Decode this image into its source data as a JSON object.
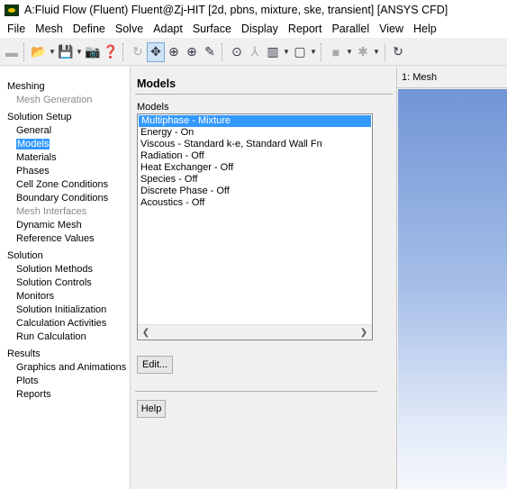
{
  "window": {
    "title": "A:Fluid Flow (Fluent) Fluent@Zj-HIT  [2d, pbns, mixture, ske, transient] [ANSYS CFD]"
  },
  "menubar": {
    "items": [
      "File",
      "Mesh",
      "Define",
      "Solve",
      "Adapt",
      "Surface",
      "Display",
      "Report",
      "Parallel",
      "View",
      "Help"
    ]
  },
  "navigation": {
    "meshing_header": "Meshing",
    "mesh_generation": "Mesh Generation",
    "solution_setup_header": "Solution Setup",
    "setup_items": [
      "General",
      "Models",
      "Materials",
      "Phases",
      "Cell Zone Conditions",
      "Boundary Conditions",
      "Mesh Interfaces",
      "Dynamic Mesh",
      "Reference Values"
    ],
    "solution_header": "Solution",
    "solution_items": [
      "Solution Methods",
      "Solution Controls",
      "Monitors",
      "Solution Initialization",
      "Calculation Activities",
      "Run Calculation"
    ],
    "results_header": "Results",
    "results_items": [
      "Graphics and Animations",
      "Plots",
      "Reports"
    ],
    "selected": "Models"
  },
  "task_page": {
    "title": "Models",
    "list_label": "Models",
    "models": [
      "Multiphase - Mixture",
      "Energy - On",
      "Viscous - Standard k-e, Standard Wall Fn",
      "Radiation - Off",
      "Heat Exchanger - Off",
      "Species - Off",
      "Discrete Phase - Off",
      "Acoustics - Off"
    ],
    "selected_model": "Multiphase - Mixture",
    "edit_button": "Edit...",
    "help_button": "Help"
  },
  "graphics": {
    "tab_label": "1: Mesh"
  },
  "colors": {
    "selection": "#3399ff",
    "viewport_top": "#7195d6",
    "viewport_bottom": "#f5f8fd"
  }
}
